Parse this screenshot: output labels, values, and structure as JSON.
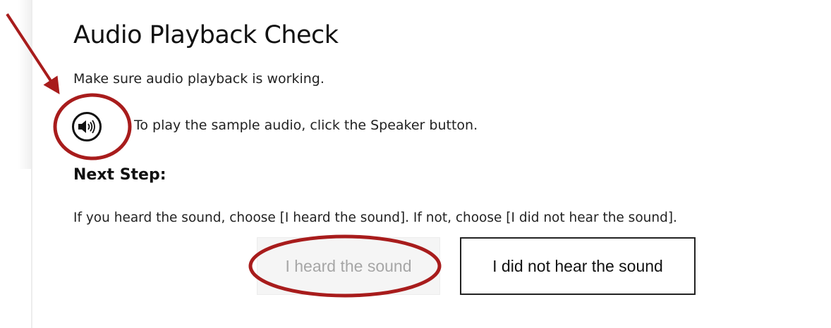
{
  "page": {
    "title": "Audio Playback Check",
    "intro": "Make sure audio playback is working.",
    "speaker_instruction": "To play the sample audio, click the Speaker button.",
    "next_step_heading": "Next Step:",
    "choice_instruction": "If you heard the sound, choose [I heard the sound]. If not, choose [I did not hear the sound]."
  },
  "buttons": {
    "heard_label": "I heard the sound",
    "not_heard_label": "I did not hear the sound",
    "heard_disabled": true
  },
  "icons": {
    "speaker": "speaker-icon"
  },
  "annotations": {
    "color": "#a81c1c"
  }
}
